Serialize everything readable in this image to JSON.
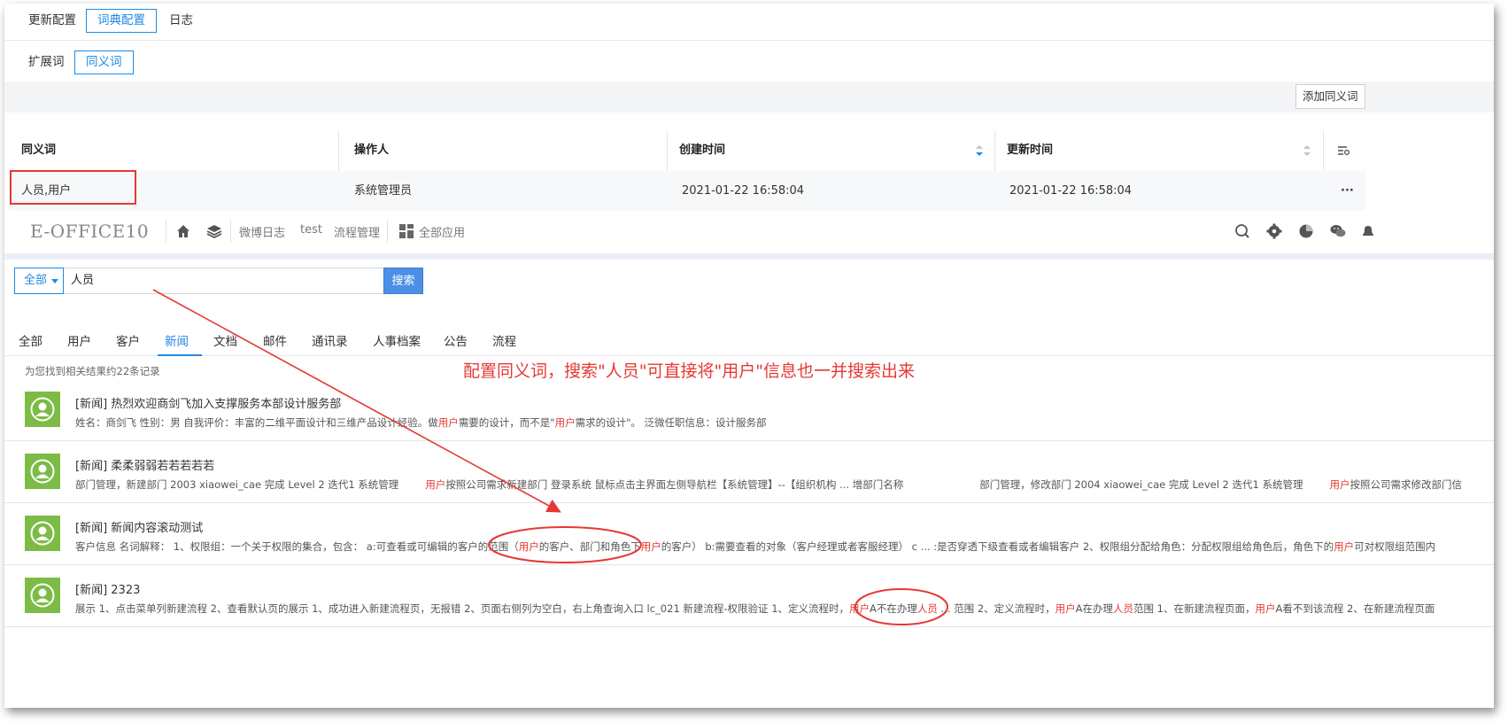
{
  "config": {
    "tabs_top": [
      "更新配置",
      "词典配置",
      "日志"
    ],
    "tabs_second": [
      "扩展词",
      "同义词"
    ],
    "add_button": "添加同义词",
    "table": {
      "headers": [
        "同义词",
        "操作人",
        "创建时间",
        "更新时间"
      ],
      "row": [
        "人员,用户",
        "系统管理员",
        "2021-01-22 16:58:04",
        "2021-01-22 16:58:04"
      ],
      "more": "···"
    }
  },
  "eoffice": {
    "logo": "E-OFFICE10",
    "nav": [
      "微博日志",
      "test",
      "流程管理",
      "全部应用"
    ],
    "search": {
      "scope": "全部",
      "query": "人员",
      "button": "搜索"
    },
    "categories": [
      "全部",
      "用户",
      "客户",
      "新闻",
      "文档",
      "邮件",
      "通讯录",
      "人事档案",
      "公告",
      "流程"
    ],
    "active_category": "新闻",
    "result_count": "为您找到相关结果约22条记录",
    "annotation": "配置同义词，搜索\"人员\"可直接将\"用户\"信息也一并搜索出来",
    "results": [
      {
        "title": "[新闻] 热烈欢迎商剑飞加入支撑服务本部设计服务部",
        "t1": "姓名：商剑飞 性别：男  自我评价：丰富的二维平面设计和三维产品设计经验。做",
        "h1": "用户",
        "t2": "需要的设计，而不是\"",
        "h2": "用户",
        "t3": "需求的设计\"。  泛微任职信息：设计服务部"
      },
      {
        "title": "[新闻] 柔柔弱弱若若若若若",
        "a": "部门管理，新建部门 2003 xiaowei_cae 完成 Level 2 迭代1 系统管理",
        "ah": "用户",
        "b": "按照公司需求新建部门 登录系统 鼠标点击主界面左侧导航栏【系统管理】--【组织机构 ... 增部门名称",
        "c": "部门管理，修改部门 2004 xiaowei_cae 完成 Level 2 迭代1 系统管理",
        "ch": "用户",
        "d": "按照公司需求修改部门信"
      },
      {
        "title": "[新闻] 新闻内容滚动测试",
        "t1": "客户信息 名词解释： 1、权限组：一个关于权限的集合，包含： a:可查看或可编辑的客户的范围（",
        "h1": "用户",
        "t2": "的客户、部门和角色下",
        "h2": "用户",
        "t3": "的客户）  b:需要查看的对象（客户经理或者客服经理） c ... :是否穿透下级查看或者编辑客户 2、权限组分配给角色：分配权限组给角色后，角色下的",
        "h3": "用户",
        "t4": "可对权限组范围内"
      },
      {
        "title": "[新闻] 2323",
        "t1": "展示 1、点击菜单列新建流程 2、查看默认页的展示 1、成功进入新建流程页，无报错 2、页面右侧列为空白，右上角查询入口     lc_021 新建流程-权限验证 1、定义流程时，",
        "h1": "用户",
        "t2": "A不在办理",
        "h2": "人员",
        "t3": " ... 范围 2、定义流程时，",
        "h3": "用户",
        "t4": "A在办理",
        "h4": "人员",
        "t5": "范围 1、在新建流程页面，",
        "h5": "用户",
        "t6": "A看不到该流程 2、在新建流程页面"
      }
    ]
  },
  "colors": {
    "accent": "#1f8ae4",
    "highlight": "#e53935",
    "avatar": "#7cbb45"
  }
}
